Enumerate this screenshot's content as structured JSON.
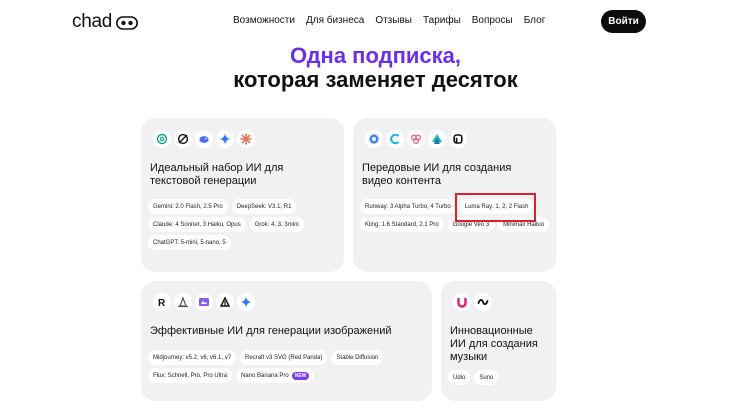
{
  "brand": {
    "name": "chad"
  },
  "nav": {
    "links": [
      "Возможности",
      "Для бизнеса",
      "Отзывы",
      "Тарифы",
      "Вопросы",
      "Блог"
    ],
    "login_label": "Войти"
  },
  "hero": {
    "line1": "Одна подписка,",
    "line2": "которая заменяет десяток"
  },
  "cards": [
    {
      "title": "Идеальный набор ИИ для текстовой генерации",
      "icons": [
        "openai-icon",
        "grok-icon",
        "deepseek-icon",
        "gemini-icon",
        "claude-icon"
      ],
      "chips": [
        "Gemini: 2.0 Flash, 2.5 Pro",
        "DeepSeek: V3.1, R1",
        "Claude: 4 Sonnet, 3 Haiku, Opus",
        "Grok: 4, 3, 3mini",
        "ChatGPT: 5-mini, 5-nano, 5"
      ]
    },
    {
      "title": "Передовые ИИ для создания видео контента",
      "icons": [
        "veo-icon",
        "runway-icon",
        "kling-icon",
        "minimax-icon",
        "luma-icon"
      ],
      "chips": [
        "Runway: 3 Alpha Turbo, 4 Turbo",
        "Luma Ray: 1, 2, 2 Flash",
        "Kling: 1.6 Standard, 2.1 Pro",
        "Google Veo 3",
        "Minimax Hailuo"
      ]
    },
    {
      "title": "Эффективные ИИ для генерации изображений",
      "icons": [
        "recraft-icon",
        "midjourney-icon",
        "stable-diffusion-icon",
        "flux-icon",
        "gemini-icon"
      ],
      "chips": [
        "Midjourney: v5.2, v6, v6.1, v7",
        "Recraft v3 SVG (Red Panda)",
        "Stable Diffusion",
        "Flux: Schnell, Pro, Pro Ultra",
        "Nano Banana Pro"
      ],
      "new_badge": "NEW"
    },
    {
      "title": "Инновационные ИИ для создания музыки",
      "icons": [
        "udio-icon",
        "suno-icon"
      ],
      "chips": [
        "Udio",
        "Suno"
      ]
    }
  ],
  "colors": {
    "accent": "#6c2ee6",
    "highlight": "#d8222b",
    "card_bg": "#f1f1f3",
    "button_bg": "#0d0d0d"
  }
}
